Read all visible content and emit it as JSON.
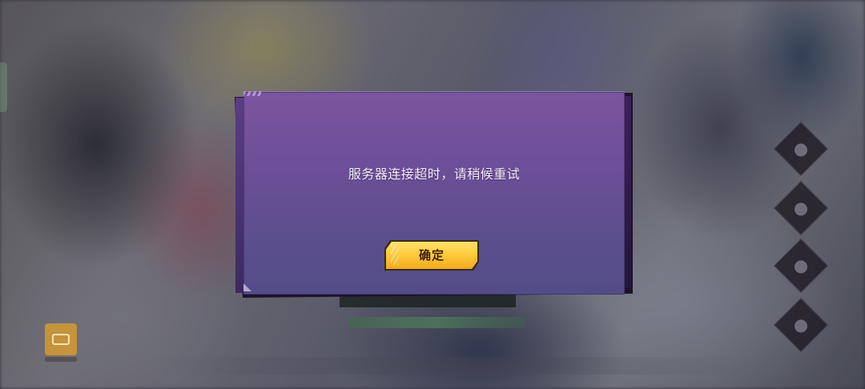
{
  "background": {
    "description_icons": [
      "bag-icon",
      "skill-icon-1",
      "skill-icon-2",
      "skill-icon-3",
      "skill-icon-4"
    ]
  },
  "dialog": {
    "message": "服务器连接超时，请稍候重试",
    "confirm_label": "确定",
    "colors": {
      "panel_top": "#7b559e",
      "panel_bottom": "#534c87",
      "button_top": "#ffe16a",
      "button_bottom": "#f0a91e",
      "button_text": "#3b2208",
      "message_text": "#f4eefb"
    }
  }
}
